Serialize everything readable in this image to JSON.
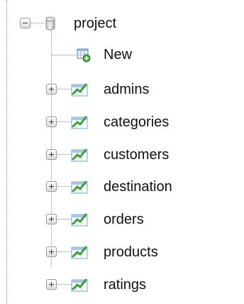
{
  "tree": {
    "database": {
      "name": "project",
      "expanded": true,
      "icon": "database-icon",
      "expander_icon": "collapse-minus-icon"
    },
    "new_item": {
      "label": "New",
      "icon": "new-table-icon"
    },
    "tables": [
      {
        "label": "admins"
      },
      {
        "label": "categories"
      },
      {
        "label": "customers"
      },
      {
        "label": "destination"
      },
      {
        "label": "orders"
      },
      {
        "label": "products"
      },
      {
        "label": "ratings"
      }
    ],
    "table_icon": "table-view-icon",
    "table_expander_icon": "expand-plus-icon"
  }
}
